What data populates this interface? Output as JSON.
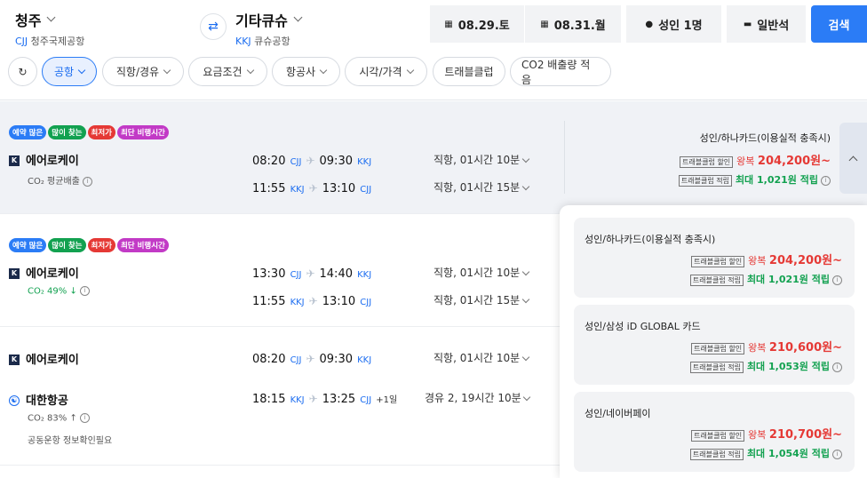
{
  "header": {
    "origin": {
      "city": "청주",
      "code": "CJJ",
      "airport": "청주국제공항"
    },
    "destination": {
      "city": "기타큐슈",
      "code": "KKJ",
      "airport": "큐슈공항"
    },
    "depart_date": "08.29.토",
    "return_date": "08.31.월",
    "passengers": "성인 1명",
    "cabin": "일반석",
    "search_label": "검색"
  },
  "filters": {
    "refresh_icon": "refresh-icon",
    "chips": [
      "공항",
      "직항/경유",
      "요금조건",
      "항공사",
      "시각/가격",
      "트래블클럽",
      "CO2 배출량 적음"
    ]
  },
  "badges": [
    "예약 많은",
    "많이 찾는",
    "최저가",
    "최단 비행시간"
  ],
  "results": [
    {
      "airline": "에어로케이",
      "co2": "CO₂ 평균배출",
      "outbound": {
        "dep": "08:20",
        "dep_code": "CJJ",
        "arr": "09:30",
        "arr_code": "KKJ",
        "duration": "직항, 01시간 10분"
      },
      "inbound": {
        "dep": "11:55",
        "dep_code": "KKJ",
        "arr": "13:10",
        "arr_code": "CJJ",
        "duration": "직항, 01시간 15분"
      },
      "price_label": "성인/하나카드(이용실적 충족시)",
      "discount_tag": "트래블클럽 할인",
      "roundtrip": "왕복",
      "price": "204,200원~",
      "points_tag": "트래블클럽 적립",
      "points": "최대 1,021원 적립"
    },
    {
      "airline": "에어로케이",
      "co2": "CO₂ 49% ↓",
      "outbound": {
        "dep": "13:30",
        "dep_code": "CJJ",
        "arr": "14:40",
        "arr_code": "KKJ",
        "duration": "직항, 01시간 10분"
      },
      "inbound": {
        "dep": "11:55",
        "dep_code": "KKJ",
        "arr": "13:10",
        "arr_code": "CJJ",
        "duration": "직항, 01시간 15분"
      }
    },
    {
      "airline": "에어로케이",
      "airline2": "대한항공",
      "co2": "CO₂ 83% ↑",
      "codeshare": "공동운항 정보확인필요",
      "outbound": {
        "dep": "08:20",
        "dep_code": "CJJ",
        "arr": "09:30",
        "arr_code": "KKJ",
        "duration": "직항, 01시간 10분"
      },
      "inbound": {
        "dep": "18:15",
        "dep_code": "KKJ",
        "arr": "13:25",
        "arr_code": "CJJ",
        "plus_day": "+1일",
        "duration": "경유 2, 19시간 10분"
      }
    }
  ],
  "popup": [
    {
      "label": "성인/하나카드(이용실적 충족시)",
      "discount_tag": "트래블클럽 할인",
      "roundtrip": "왕복",
      "price": "204,200원~",
      "points_tag": "트래블클럽 적립",
      "points": "최대 1,021원 적립"
    },
    {
      "label": "성인/삼성 iD GLOBAL 카드",
      "discount_tag": "트래블클럽 할인",
      "roundtrip": "왕복",
      "price": "210,600원~",
      "points_tag": "트래블클럽 적립",
      "points": "최대 1,053원 적립"
    },
    {
      "label": "성인/네이버페이",
      "discount_tag": "트래블클럽 할인",
      "roundtrip": "왕복",
      "price": "210,700원~",
      "points_tag": "트래블클럽 적립",
      "points": "최대 1,054원 적립"
    }
  ],
  "colors": {
    "accent": "#2b7cf6",
    "price_red": "#e53935",
    "points_green": "#12a150"
  }
}
